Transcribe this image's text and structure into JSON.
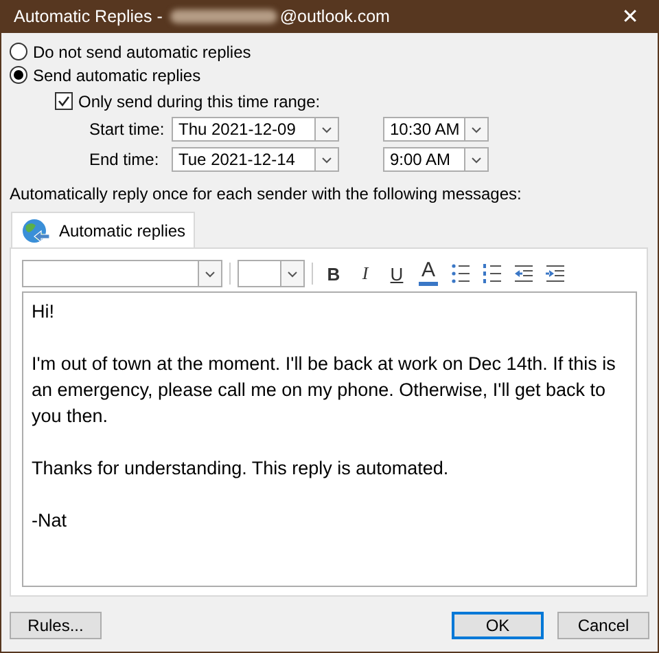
{
  "window": {
    "title_prefix": "Automatic Replies - ",
    "redacted": true,
    "title_suffix": "@outlook.com",
    "close": "✕"
  },
  "options": [
    {
      "label": "Do not send automatic replies",
      "selected": false
    },
    {
      "label": "Send automatic replies",
      "selected": true
    }
  ],
  "time_range": {
    "label": "Only send during this time range:",
    "checked": true,
    "rows": [
      {
        "label": "Start time:",
        "date": "Thu 2021-12-09",
        "time": "10:30 AM"
      },
      {
        "label": "End time:",
        "date": "Tue 2021-12-14",
        "time": "9:00 AM"
      }
    ]
  },
  "instruction": "Automatically reply once for each sender with the following messages:",
  "tabs": [
    {
      "label": "Automatic replies",
      "selected": true
    }
  ],
  "format_buttons": [
    {
      "kind": "bold",
      "label": "B"
    },
    {
      "kind": "italic",
      "label": "I"
    },
    {
      "kind": "underline",
      "label": "U"
    },
    {
      "kind": "color",
      "label": "A"
    },
    {
      "kind": "bullets"
    },
    {
      "kind": "numbering"
    },
    {
      "kind": "outdent"
    },
    {
      "kind": "indent"
    }
  ],
  "message": [
    "Hi!",
    "I'm out of town at the moment. I'll be back at work on Dec 14th. If this is an emergency, please call me on my phone. Otherwise, I'll get back to you then.",
    "Thanks for understanding. This reply is automated.",
    "-Nat"
  ],
  "buttons": [
    {
      "label": "Rules...",
      "default": false
    },
    {
      "label": "OK",
      "default": true
    },
    {
      "label": "Cancel",
      "default": false
    }
  ]
}
